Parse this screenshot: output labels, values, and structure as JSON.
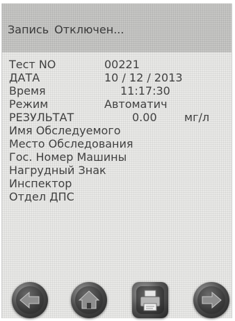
{
  "header": {
    "section": "Запись",
    "status": "Отключен..."
  },
  "record": {
    "test_no_label": "Тест NO",
    "test_no_value": "00221",
    "date_label": "ДАТА",
    "date_value": "10 / 12 / 2013",
    "time_label": "Время",
    "time_value": "11:17:30",
    "mode_label": "Режим",
    "mode_value": "Автоматич",
    "result_label": "РЕЗУЛЬТАТ",
    "result_value": "0.00",
    "result_unit": "мг/л",
    "subject_name_label": "Имя Обследуемого",
    "location_label": "Место Обследования",
    "plate_label": "Гос. Номер Машины",
    "badge_label": "Нагрудный Знак",
    "inspector_label": "Инспектор",
    "department_label": "Отдел ДПС"
  },
  "toolbar": {
    "buttons": [
      {
        "icon": "arrow-left-icon"
      },
      {
        "icon": "home-icon"
      },
      {
        "icon": "printer-icon"
      },
      {
        "icon": "arrow-right-icon"
      }
    ]
  },
  "colors": {
    "screen_bg": "#e9e9e7",
    "header_bg": "#c6c6c4",
    "text": "#404040",
    "button_dark": "#2a2a2a"
  }
}
